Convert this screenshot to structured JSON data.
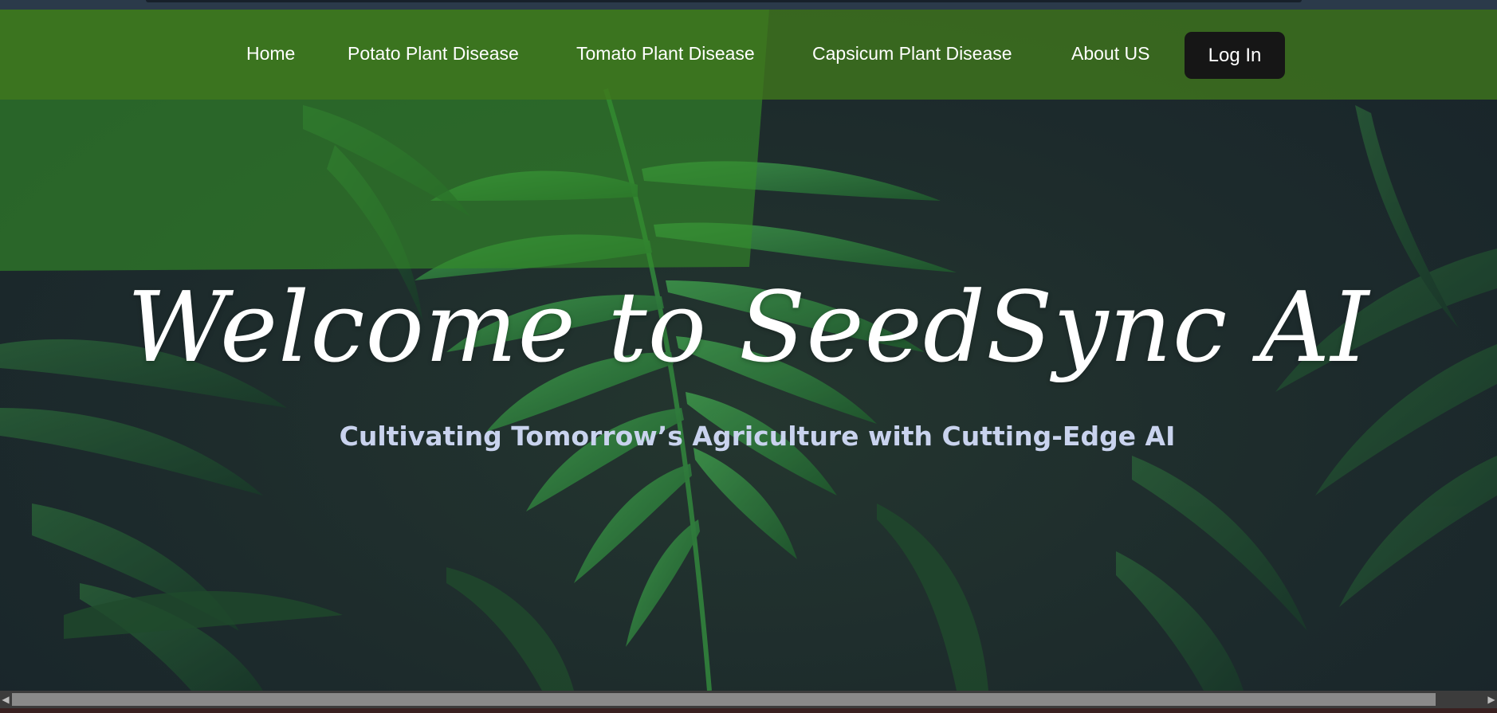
{
  "nav": {
    "items": [
      {
        "label": "Home"
      },
      {
        "label": "Potato Plant Disease"
      },
      {
        "label": "Tomato Plant Disease"
      },
      {
        "label": "Capsicum Plant Disease"
      },
      {
        "label": "About US"
      }
    ],
    "login_label": "Log In"
  },
  "hero": {
    "title": "Welcome to SeedSync AI",
    "subtitle": "Cultivating Tomorrow’s Agriculture with Cutting-Edge AI"
  },
  "colors": {
    "navbar": "#40781c",
    "login_button": "#161616",
    "subtitle_text": "#c9d3ee",
    "background": "#1e2b2e"
  },
  "icons": {
    "scroll_left": "chevron-left-icon",
    "scroll_right": "chevron-right-icon"
  }
}
